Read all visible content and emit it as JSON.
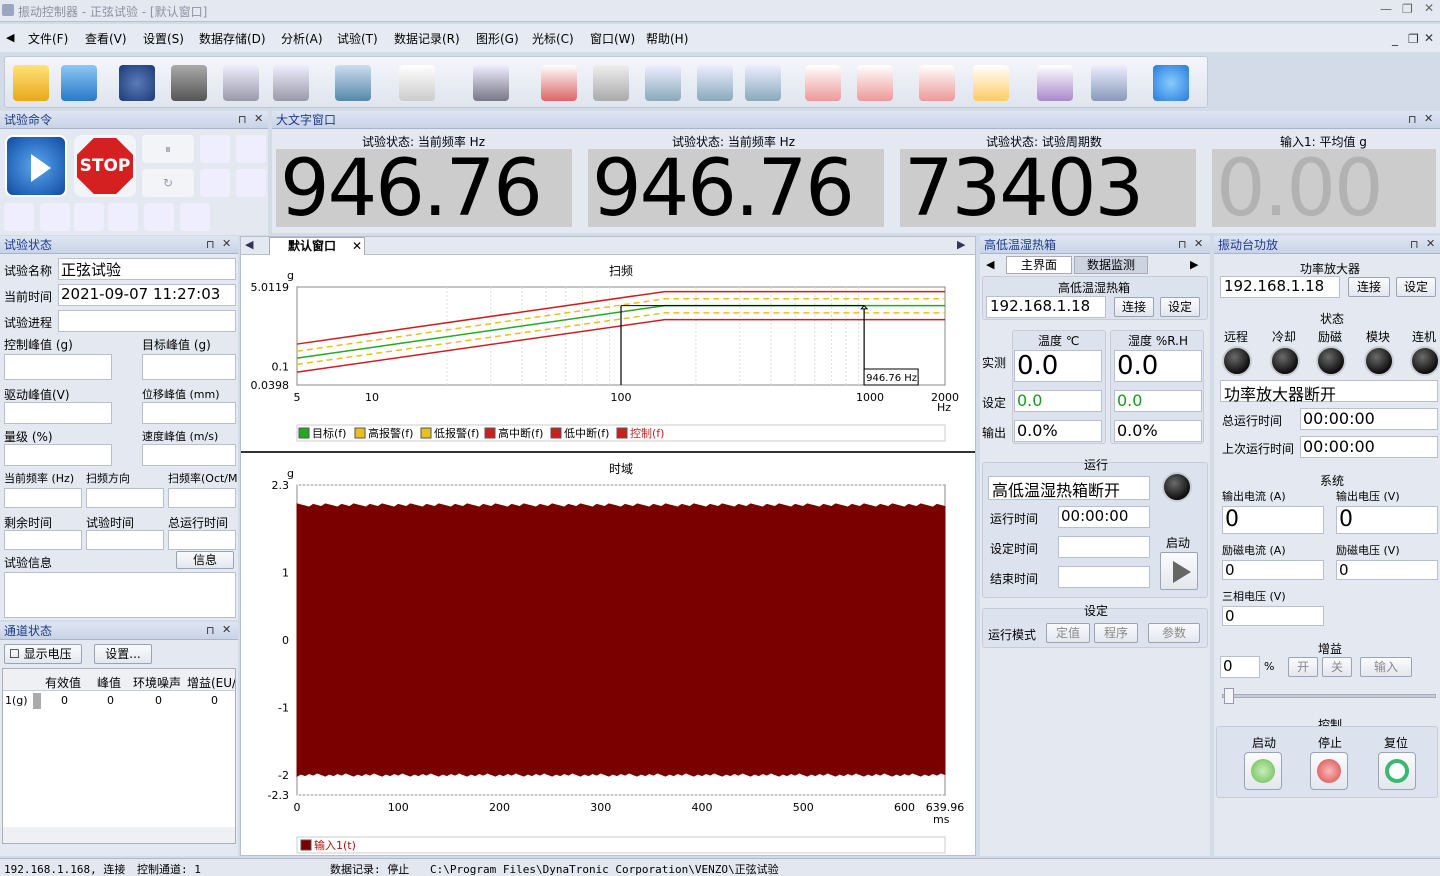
{
  "window": {
    "title": "振动控制器 - 正弦试验 - [默认窗口]"
  },
  "menu": [
    "文件(F)",
    "查看(V)",
    "设置(S)",
    "数据存储(D)",
    "分析(A)",
    "试验(T)",
    "数据记录(R)",
    "图形(G)",
    "光标(C)",
    "窗口(W)",
    "帮助(H)"
  ],
  "panels": {
    "test_cmd": "试验命令",
    "big_text": "大文字窗口",
    "test_status": "试验状态",
    "channel_status": "通道状态",
    "chamber": "高低温湿热箱",
    "amp": "振动台功放"
  },
  "big": {
    "items": [
      {
        "label": "试验状态: 当前频率 Hz",
        "value": "946.76"
      },
      {
        "label": "试验状态: 当前频率 Hz",
        "value": "946.76"
      },
      {
        "label": "试验状态: 试验周期数",
        "value": "73403"
      },
      {
        "label": "输入1: 平均值 g",
        "value": "0.00"
      }
    ]
  },
  "test_status": {
    "name_label": "试验名称",
    "name_value": "正弦试验",
    "time_label": "当前时间",
    "time_value": "2021-09-07 11:27:03",
    "progress_label": "试验进程",
    "ctrl_peak": "控制峰值 (g)",
    "target_peak": "目标峰值 (g)",
    "drive_peak": "驱动峰值(V)",
    "disp_peak": "位移峰值 (mm)",
    "level": "量级 (%)",
    "vel_peak": "速度峰值 (m/s)",
    "cur_freq": "当前频率 (Hz)",
    "sweep_dir": "扫频方向",
    "sweep_rate": "扫频率(Oct/M",
    "remain": "剩余时间",
    "test_time": "试验时间",
    "total_time": "总运行时间",
    "info_label": "试验信息",
    "info_btn": "信息"
  },
  "channel": {
    "show_voltage": "显示电压",
    "settings_btn": "设置...",
    "columns": [
      "有效值",
      "峰值",
      "环境噪声",
      "增益(EU/"
    ],
    "rows": [
      {
        "name": "1(g)",
        "values": [
          "0",
          "0",
          "0",
          "0"
        ]
      }
    ]
  },
  "tabs": {
    "active": "默认窗口"
  },
  "sweep_chart": {
    "title": "扫频",
    "yunit": "g",
    "xunit": "Hz",
    "yticks": [
      "5.0119",
      "0.1",
      "0.0398"
    ],
    "xticks": [
      "5",
      "10",
      "100",
      "1000",
      "2000"
    ],
    "cursor_label": "946.76 Hz",
    "legend": [
      {
        "label": "目标(f)",
        "color": "#22aa22"
      },
      {
        "label": "高报警(f)",
        "color": "#e8c020"
      },
      {
        "label": "低报警(f)",
        "color": "#e8c020"
      },
      {
        "label": "高中断(f)",
        "color": "#cc2020"
      },
      {
        "label": "低中断(f)",
        "color": "#cc2020"
      },
      {
        "label": "控制(f)",
        "color": "#cc2020"
      }
    ]
  },
  "time_chart": {
    "title": "时域",
    "yunit": "g",
    "xunit": "ms",
    "yticks": [
      "2.3",
      "1",
      "0",
      "-1",
      "-2",
      "-2.3"
    ],
    "xticks": [
      "0",
      "100",
      "200",
      "300",
      "400",
      "500",
      "600",
      "639.96"
    ],
    "legend": "输入1(t)",
    "color": "#7a0000"
  },
  "chart_data": [
    {
      "type": "line",
      "title": "扫频",
      "xlabel": "Hz",
      "ylabel": "g",
      "xscale": "log",
      "yscale": "log",
      "xlim": [
        5,
        2000
      ],
      "ylim": [
        0.0398,
        5.0119
      ],
      "series": [
        {
          "name": "目标(f)",
          "x": [
            5,
            150,
            2000
          ],
          "y": [
            0.15,
            2.0,
            2.0
          ]
        },
        {
          "name": "高报警(f)",
          "x": [
            5,
            150,
            2000
          ],
          "y": [
            0.21,
            2.8,
            2.8
          ]
        },
        {
          "name": "低报警(f)",
          "x": [
            5,
            150,
            2000
          ],
          "y": [
            0.11,
            1.4,
            1.4
          ]
        },
        {
          "name": "高中断(f)",
          "x": [
            5,
            150,
            2000
          ],
          "y": [
            0.3,
            4.0,
            4.0
          ]
        },
        {
          "name": "低中断(f)",
          "x": [
            5,
            150,
            2000
          ],
          "y": [
            0.075,
            1.0,
            1.0
          ]
        }
      ],
      "cursors": [
        100,
        946.76
      ]
    },
    {
      "type": "area",
      "title": "时域",
      "xlabel": "ms",
      "ylabel": "g",
      "xlim": [
        0,
        639.96
      ],
      "ylim": [
        -2.3,
        2.3
      ],
      "series": [
        {
          "name": "输入1(t)",
          "envelope_max": 2.02,
          "envelope_min": -2.02
        }
      ]
    }
  ],
  "chamber": {
    "tabs": [
      "主界面",
      "数据监测"
    ],
    "group": "高低温湿热箱",
    "ip": "192.168.1.18",
    "connect": "连接",
    "set": "设定",
    "temp_label": "温度 ℃",
    "hum_label": "湿度 %R.H",
    "row_labels": [
      "实测",
      "设定",
      "输出"
    ],
    "temp": [
      "0.0",
      "0.0",
      "0.0%"
    ],
    "hum": [
      "0.0",
      "0.0",
      "0.0%"
    ],
    "run_group": "运行",
    "run_status": "高低温湿热箱断开",
    "run_time": "运行时间",
    "run_time_val": "00:00:00",
    "set_time": "设定时间",
    "end_time": "结束时间",
    "start": "启动",
    "set_group": "设定",
    "mode_label": "运行模式",
    "mode_btns": [
      "定值",
      "程序"
    ],
    "param": "参数"
  },
  "amp": {
    "group": "功率放大器",
    "ip": "192.168.1.18",
    "connect": "连接",
    "set": "设定",
    "state_group": "状态",
    "lamps": [
      "远程",
      "冷却",
      "励磁",
      "模块",
      "连机"
    ],
    "status": "功率放大器断开",
    "total_run": "总运行时间",
    "total_run_val": "00:00:00",
    "last_run": "上次运行时间",
    "last_run_val": "00:00:00",
    "sys_group": "系统",
    "out_cur": "输出电流 (A)",
    "out_vol": "输出电压 (V)",
    "out_cur_val": "0",
    "out_vol_val": "0",
    "ex_cur": "励磁电流 (A)",
    "ex_vol": "励磁电压 (V)",
    "ex_cur_val": "0",
    "ex_vol_val": "0",
    "three": "三相电压 (V)",
    "three_val": "0",
    "gain_group": "增益",
    "gain_val": "0",
    "pct": "%",
    "on": "开",
    "off": "关",
    "input": "输入",
    "ctrl_group": "控制",
    "start": "启动",
    "stop": "停止",
    "reset": "复位"
  },
  "status": {
    "conn": "192.168.1.168, 连接",
    "ctrl": "控制通道: 1",
    "rec": "数据记录: 停止",
    "path": "C:\\Program Files\\DynaTronic Corporation\\VENZO\\正弦试验"
  }
}
